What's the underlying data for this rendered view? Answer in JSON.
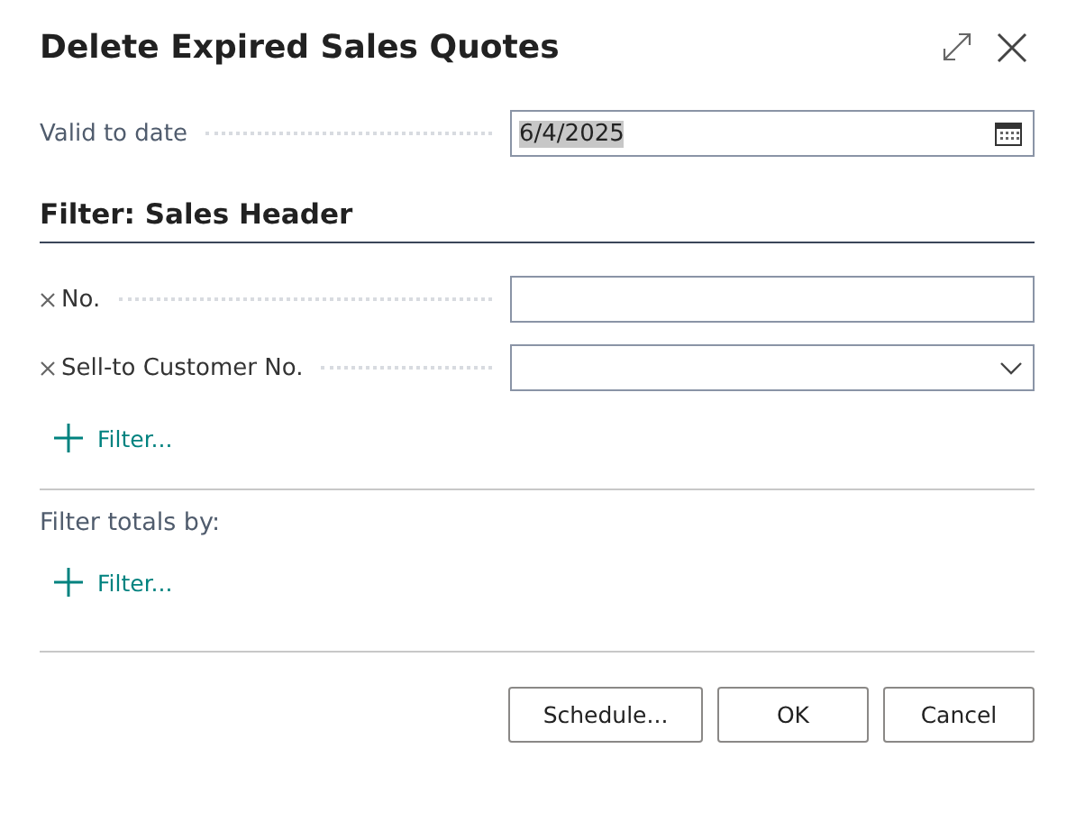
{
  "window": {
    "title": "Delete Expired Sales Quotes"
  },
  "options": [
    {
      "label": "Valid to date",
      "value": "6/4/2025",
      "kind": "date",
      "text_selected": true
    }
  ],
  "filter_section": {
    "heading": "Filter: Sales Header",
    "filters": [
      {
        "label": "No.",
        "kind": "text"
      },
      {
        "label": "Sell-to Customer No.",
        "kind": "dropdown"
      }
    ],
    "add_filter": "Filter..."
  },
  "totals_section": {
    "heading": "Filter totals by:",
    "add_filter": "Filter..."
  },
  "buttons": [
    "Schedule...",
    "OK",
    "Cancel"
  ]
}
